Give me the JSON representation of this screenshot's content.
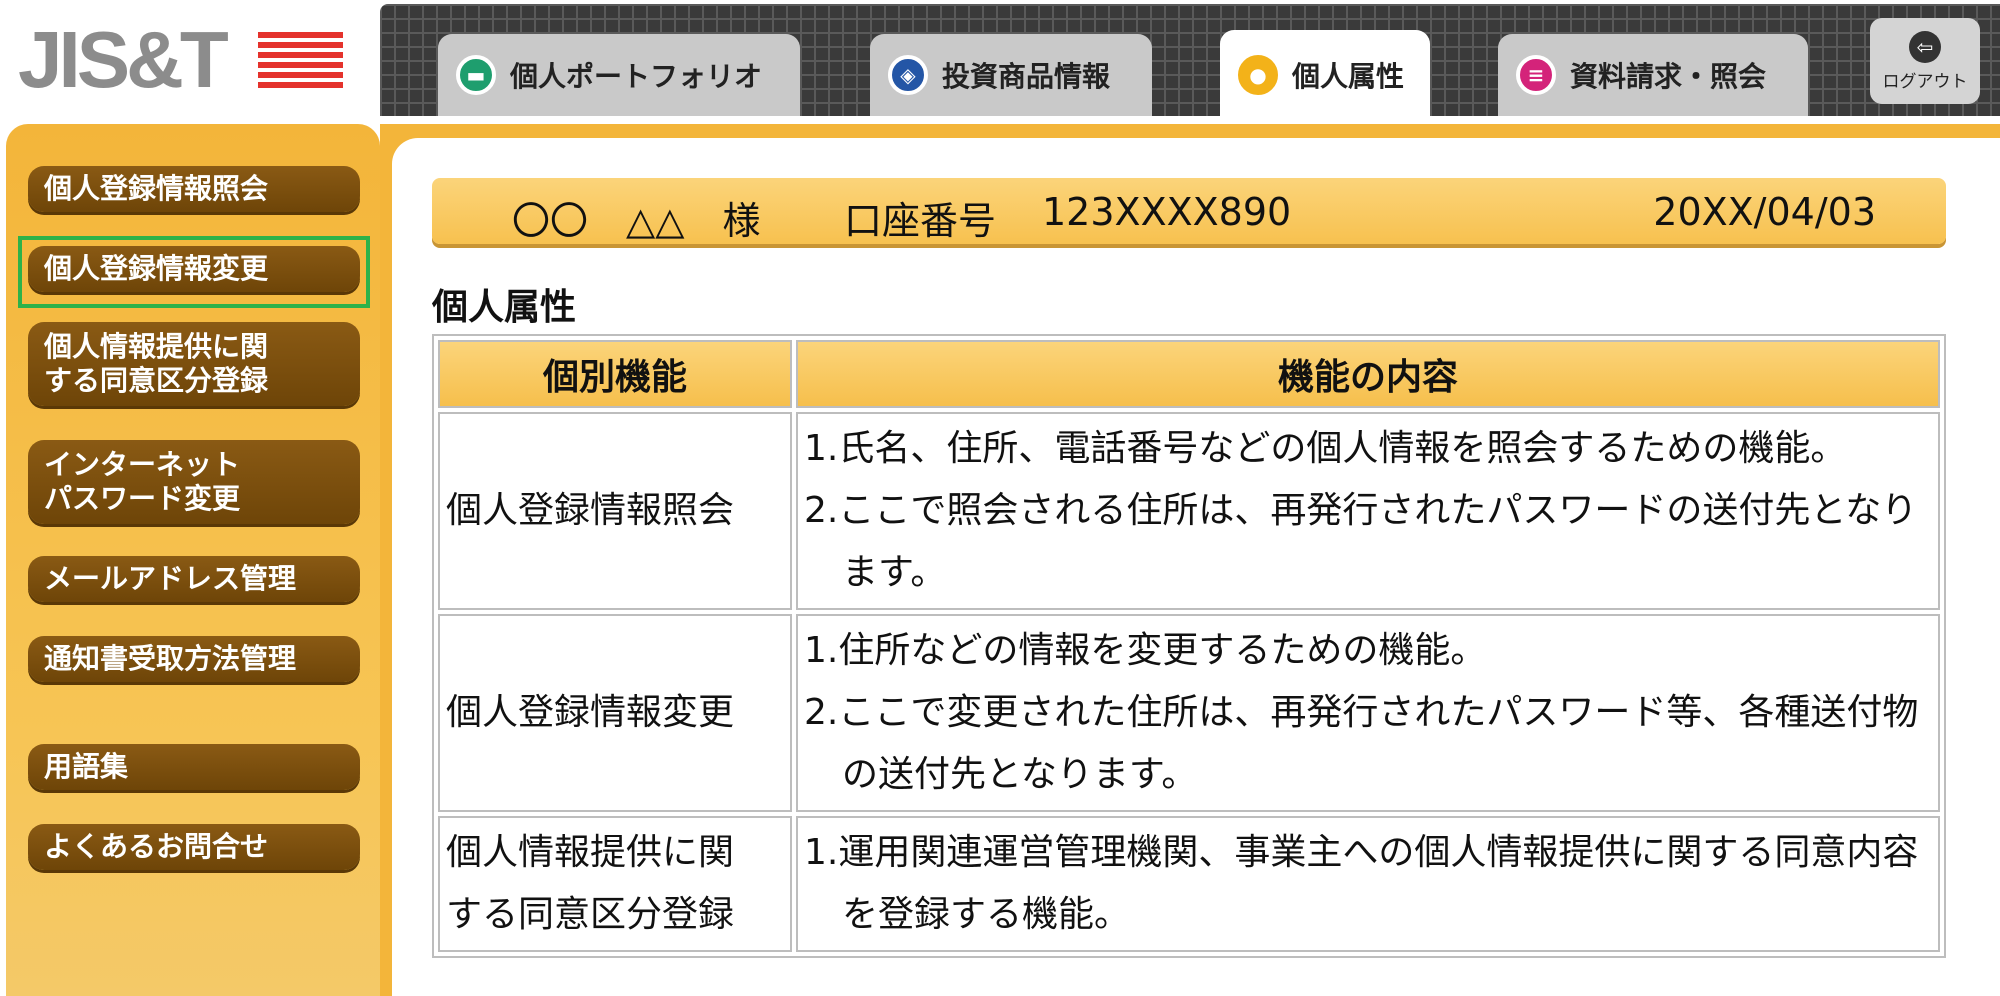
{
  "logo": {
    "text": "JIS&T"
  },
  "tabs": [
    {
      "label": "個人ポートフォリオ",
      "icon": "folder-icon"
    },
    {
      "label": "投資商品情報",
      "icon": "cube-icon"
    },
    {
      "label": "個人属性",
      "icon": "person-icon",
      "active": true
    },
    {
      "label": "資料請求・照会",
      "icon": "document-icon"
    }
  ],
  "logout": {
    "label": "ログアウト",
    "icon": "logout-arrow-icon"
  },
  "sidebar": {
    "items": [
      {
        "label": "個人登録情報照会"
      },
      {
        "label": "個人登録情報変更",
        "highlighted": true
      },
      {
        "line1": "個人情報提供に関",
        "line2": "する同意区分登録"
      },
      {
        "line1": "インターネット",
        "line2": "パスワード変更"
      },
      {
        "label": "メールアドレス管理"
      },
      {
        "label": "通知書受取方法管理"
      },
      {
        "label": "用語集"
      },
      {
        "label": "よくあるお問合せ"
      }
    ],
    "highlight_color": "#2db24a"
  },
  "userbar": {
    "name": "〇〇　△△　様",
    "account_label": "口座番号",
    "account_number": "123XXXX890",
    "date": "20XX/04/03"
  },
  "section_title": "個人属性",
  "table": {
    "headers": [
      "個別機能",
      "機能の内容"
    ],
    "rows": [
      {
        "feature": "個人登録情報照会",
        "desc": [
          "1.氏名、住所、電話番号などの個人情報を照会するための機能。",
          "2.ここで照会される住所は、再発行されたパスワードの送付先となります。"
        ]
      },
      {
        "feature": "個人登録情報変更",
        "desc": [
          "1.住所などの情報を変更するための機能。",
          "2.ここで変更された住所は、再発行されたパスワード等、各種送付物の送付先となります。"
        ]
      },
      {
        "feature_line1": "個人情報提供に関",
        "feature_line2": "する同意区分登録",
        "desc": [
          "1.運用関連運営管理機関、事業主への個人情報提供に関する同意内容を登録する機能。"
        ]
      }
    ]
  },
  "colors": {
    "accent_orange": "#f3b53a",
    "sidebar_button": "#7a4d0e",
    "tab_bar": "#3a3a3a"
  }
}
